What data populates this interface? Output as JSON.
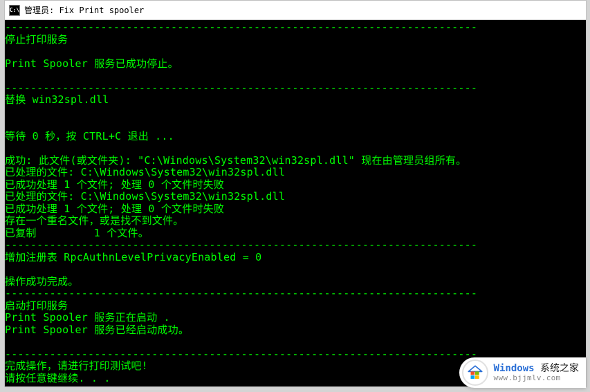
{
  "window": {
    "icon_label": "C:\\",
    "title": "管理员:  Fix Print spooler"
  },
  "terminal": {
    "lines": [
      "--------------------------------------------------------------------------",
      "停止打印服务",
      "",
      "Print Spooler 服务已成功停止。",
      "",
      "--------------------------------------------------------------------------",
      "替换 win32spl.dll",
      "",
      "",
      "等待 0 秒，按 CTRL+C 退出 ...",
      "",
      "成功: 此文件(或文件夹): \"C:\\Windows\\System32\\win32spl.dll\" 现在由管理员组所有。",
      "已处理的文件: C:\\Windows\\System32\\win32spl.dll",
      "已成功处理 1 个文件; 处理 0 个文件时失败",
      "已处理的文件: C:\\Windows\\System32\\win32spl.dll",
      "已成功处理 1 个文件; 处理 0 个文件时失败",
      "存在一个重名文件，或是找不到文件。",
      "已复制         1 个文件。",
      "--------------------------------------------------------------------------",
      "增加注册表 RpcAuthnLevelPrivacyEnabled = 0",
      "",
      "操作成功完成。",
      "--------------------------------------------------------------------------",
      "启动打印服务",
      "Print Spooler 服务正在启动 .",
      "Print Spooler 服务已经启动成功。",
      "",
      "--------------------------------------------------------------------------",
      "完成操作，请进行打印测试吧!",
      "请按任意键继续. . ."
    ]
  },
  "watermark": {
    "brand_prefix": "Windows",
    "brand_suffix": " 系统之家",
    "url": "www.bjjmlv.com",
    "logo_colors": {
      "tl": "#f25022",
      "tr": "#7fba00",
      "bl": "#00a4ef",
      "br": "#ffb900",
      "roof": "#2a6fd6"
    }
  }
}
